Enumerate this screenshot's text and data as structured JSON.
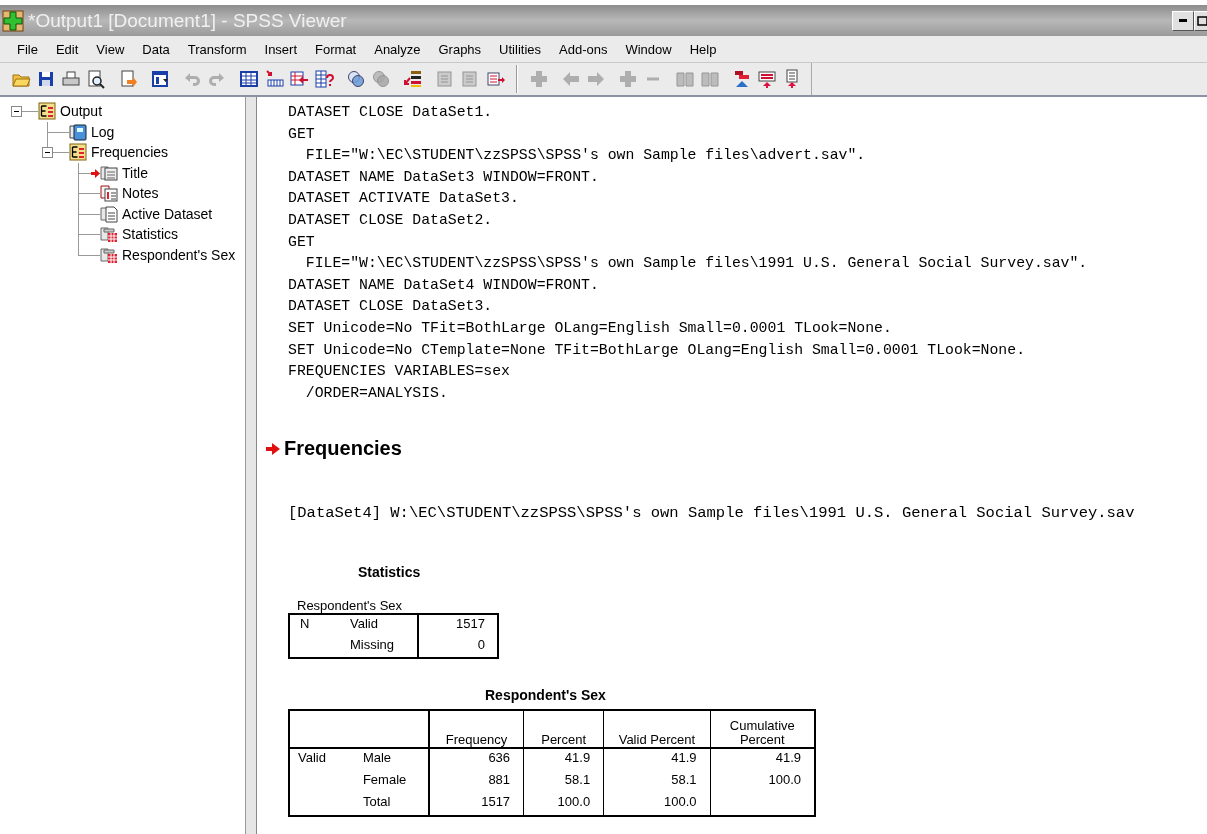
{
  "window": {
    "title": "*Output1 [Document1] - SPSS Viewer"
  },
  "menu": [
    "File",
    "Edit",
    "View",
    "Data",
    "Transform",
    "Insert",
    "Format",
    "Analyze",
    "Graphs",
    "Utilities",
    "Add-ons",
    "Window",
    "Help"
  ],
  "toolbar": [
    [
      {
        "kind": "folder",
        "disabled": false
      },
      {
        "kind": "disk",
        "disabled": false
      },
      {
        "kind": "printer",
        "disabled": false
      },
      {
        "kind": "preview",
        "disabled": false
      }
    ],
    [
      {
        "kind": "export",
        "disabled": false
      }
    ],
    [
      {
        "kind": "dialog",
        "disabled": false
      }
    ],
    [
      {
        "kind": "undo",
        "disabled": true
      },
      {
        "kind": "redo",
        "disabled": true
      }
    ],
    [
      {
        "kind": "grid",
        "disabled": false
      },
      {
        "kind": "grid-row",
        "disabled": false
      },
      {
        "kind": "grid-arrow",
        "disabled": false
      },
      {
        "kind": "grid-question",
        "disabled": false
      }
    ],
    [
      {
        "kind": "circles",
        "disabled": false
      },
      {
        "kind": "circles",
        "disabled": true
      }
    ],
    [
      {
        "kind": "list",
        "disabled": false
      }
    ],
    [
      {
        "kind": "sheet",
        "disabled": true
      },
      {
        "kind": "sheet",
        "disabled": true
      },
      {
        "kind": "sheet-arrow",
        "disabled": false
      }
    ],
    [
      {
        "kind": "plus",
        "disabled": true
      }
    ],
    [
      {
        "kind": "arrow-left",
        "disabled": true
      },
      {
        "kind": "arrow-right",
        "disabled": true
      }
    ],
    [
      {
        "kind": "plus",
        "disabled": true
      },
      {
        "kind": "minus",
        "disabled": true
      }
    ],
    [
      {
        "kind": "book",
        "disabled": true
      },
      {
        "kind": "book",
        "disabled": true
      }
    ],
    [
      {
        "kind": "bars",
        "disabled": false
      },
      {
        "kind": "doc-up",
        "disabled": false
      },
      {
        "kind": "page-up",
        "disabled": false
      }
    ]
  ],
  "outline": [
    {
      "label": "Output",
      "kind": "heading",
      "expanded": true,
      "current": false,
      "children": [
        {
          "label": "Log",
          "kind": "log",
          "current": false
        },
        {
          "label": "Frequencies",
          "kind": "heading",
          "expanded": true,
          "current": false,
          "children": [
            {
              "label": "Title",
              "kind": "title",
              "current": true
            },
            {
              "label": "Notes",
              "kind": "notes",
              "current": false
            },
            {
              "label": "Active Dataset",
              "kind": "text",
              "current": false
            },
            {
              "label": "Statistics",
              "kind": "table",
              "current": false
            },
            {
              "label": "Respondent's Sex",
              "kind": "table",
              "current": false
            }
          ]
        }
      ]
    }
  ],
  "log": [
    "DATASET CLOSE DataSet1.",
    "GET",
    "  FILE=\"W:\\EC\\STUDENT\\zzSPSS\\SPSS's own Sample files\\advert.sav\".",
    "DATASET NAME DataSet3 WINDOW=FRONT.",
    "DATASET ACTIVATE DataSet3.",
    "DATASET CLOSE DataSet2.",
    "GET",
    "  FILE=\"W:\\EC\\STUDENT\\zzSPSS\\SPSS's own Sample files\\1991 U.S. General Social Survey.sav\".",
    "DATASET NAME DataSet4 WINDOW=FRONT.",
    "DATASET CLOSE DataSet3.",
    "SET Unicode=No TFit=BothLarge OLang=English Small=0.0001 TLook=None.",
    "SET Unicode=No CTemplate=None TFit=BothLarge OLang=English Small=0.0001 TLook=None.",
    "FREQUENCIES VARIABLES=sex",
    "  /ORDER=ANALYSIS."
  ],
  "heading": {
    "title": "Frequencies",
    "current": true
  },
  "dataset_line": "[DataSet4] W:\\EC\\STUDENT\\zzSPSS\\SPSS's own Sample files\\1991 U.S. General Social Survey.sav",
  "statistics": {
    "title": "Statistics",
    "caption": "Respondent's Sex",
    "rows": [
      {
        "group": "N",
        "label": "Valid",
        "value": "1517"
      },
      {
        "label": "Missing",
        "value": "0"
      }
    ]
  },
  "frequency_table": {
    "title": "Respondent's Sex",
    "columns": [
      "Frequency",
      "Percent",
      "Valid Percent",
      "Cumulative Percent"
    ],
    "rows": [
      {
        "group": "Valid",
        "label": "Male",
        "cells": [
          "636",
          "41.9",
          "41.9",
          "41.9"
        ]
      },
      {
        "label": "Female",
        "cells": [
          "881",
          "58.1",
          "58.1",
          "100.0"
        ]
      },
      {
        "label": "Total",
        "cells": [
          "1517",
          "100.0",
          "100.0"
        ]
      }
    ]
  }
}
